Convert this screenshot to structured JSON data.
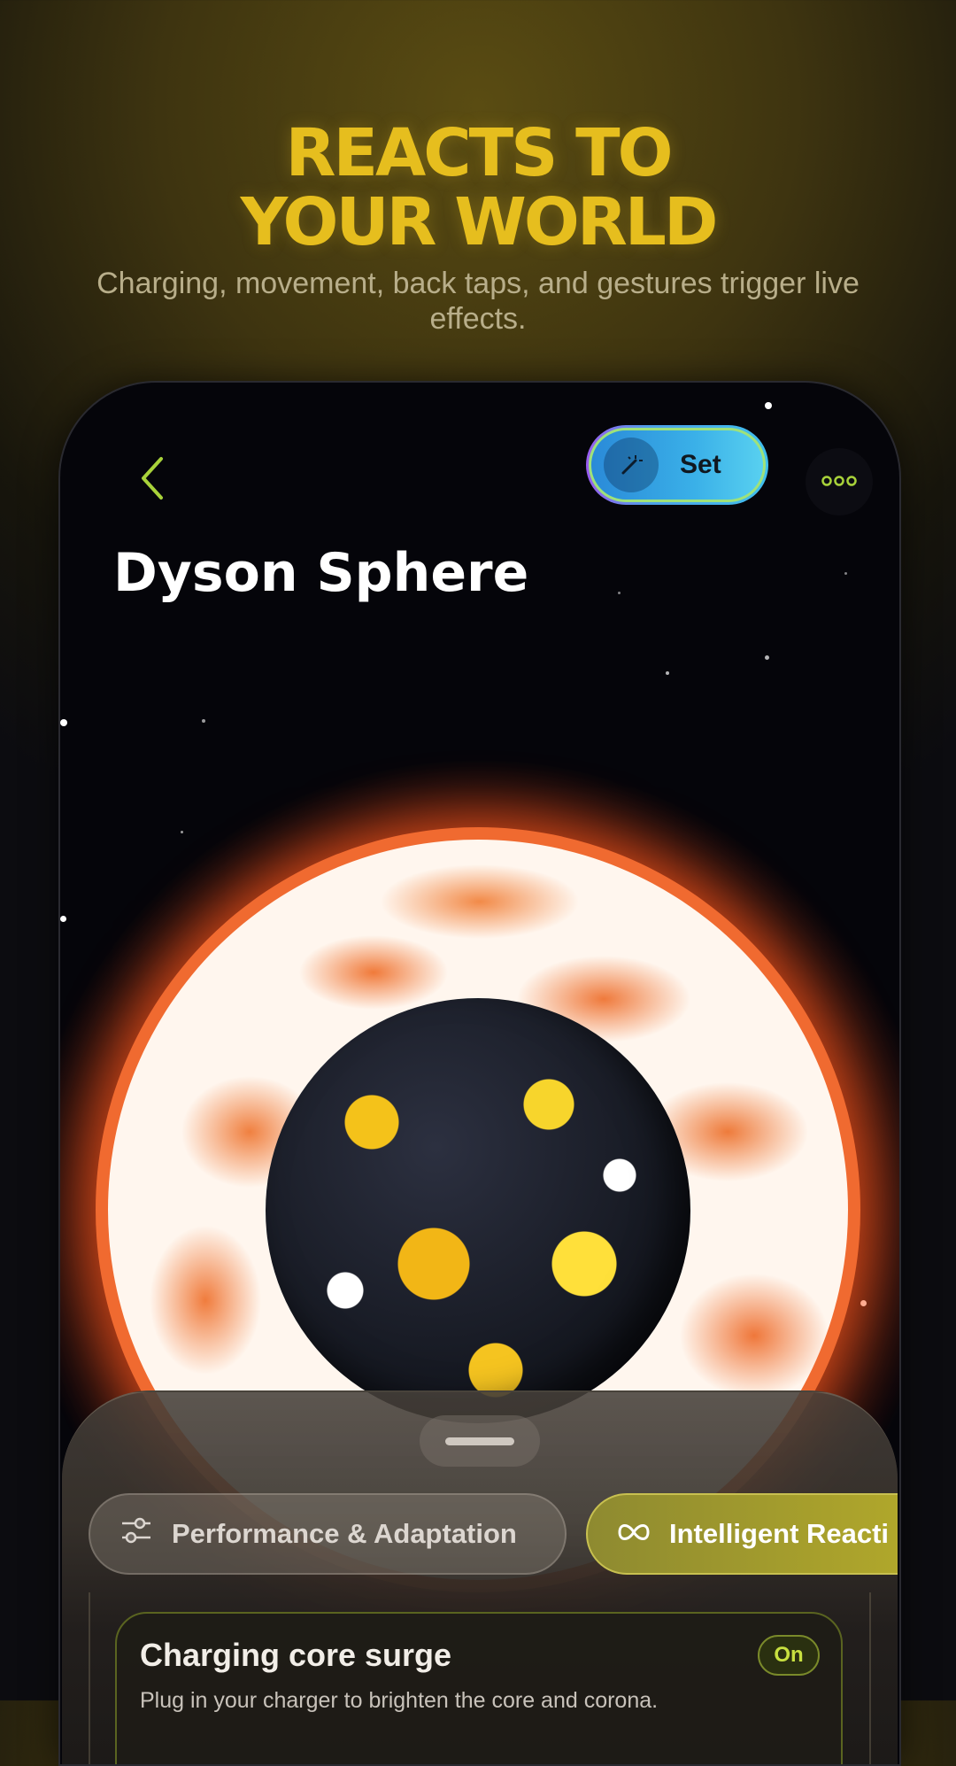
{
  "promo": {
    "headline_line1": "REACTS TO",
    "headline_line2": "YOUR WORLD",
    "subtitle": "Charging, movement, back taps, and gestures trigger live effects."
  },
  "app": {
    "header": {
      "back_icon": "chevron-left-icon",
      "set_button_label": "Set",
      "set_button_icon": "magic-wand-icon",
      "more_icon": "more-horizontal-icon"
    },
    "wallpaper_title": "Dyson Sphere",
    "sheet": {
      "tabs": [
        {
          "label": "Performance & Adaptation",
          "icon": "sliders-icon",
          "selected": false
        },
        {
          "label": "Intelligent Reacti",
          "icon": "infinity-icon",
          "selected": true
        }
      ],
      "features": [
        {
          "title": "Charging core surge",
          "description": "Plug in your charger to brighten the core and corona.",
          "status": "On"
        }
      ]
    }
  },
  "colors": {
    "headline": "#e6be1e",
    "accent_green": "#a8d23a",
    "set_gradient_start": "#2a8ad8",
    "set_gradient_end": "#58d0f0",
    "sun_orange": "#f06a30"
  }
}
